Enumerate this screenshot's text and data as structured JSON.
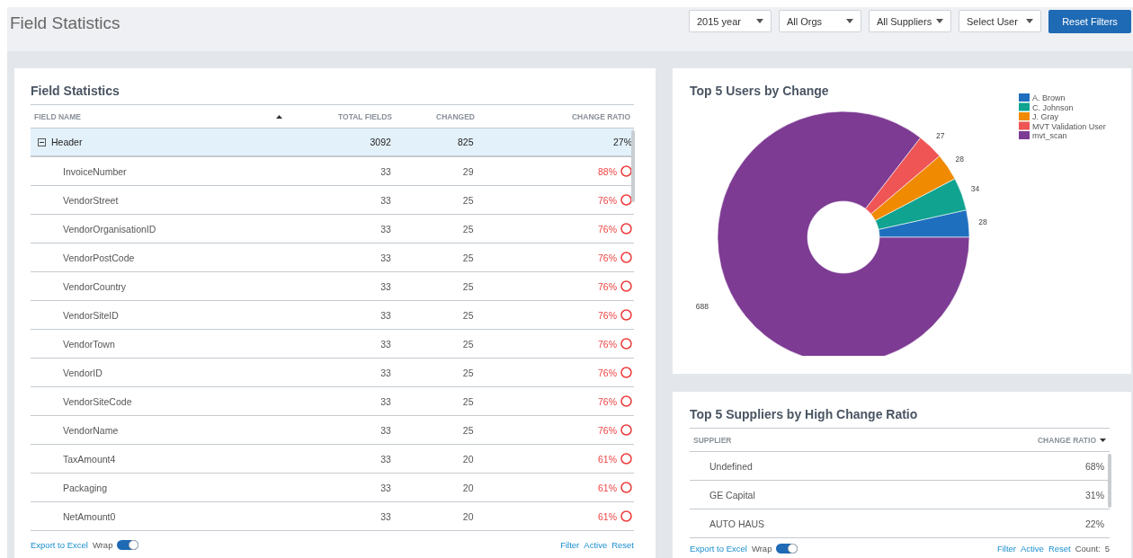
{
  "page": {
    "title": "Field Statistics"
  },
  "filters": [
    {
      "value": "2015 year"
    },
    {
      "value": "All Orgs"
    },
    {
      "value": "All Suppliers"
    },
    {
      "value": "Select User"
    }
  ],
  "reset_button": "Reset Filters",
  "field_statistics": {
    "title": "Field Statistics",
    "columns": [
      "FIELD NAME",
      "TOTAL FIELDS",
      "CHANGED",
      "CHANGE RATIO"
    ],
    "rows": [
      {
        "name": "Header",
        "total": "3092",
        "changed": "825",
        "ratio": "27%",
        "expanded": true,
        "selected": true,
        "alert": false,
        "children": [
          {
            "name": "InvoiceNumber",
            "total": "33",
            "changed": "29",
            "ratio": "88%",
            "selected": false,
            "alert": true
          },
          {
            "name": "VendorStreet",
            "total": "33",
            "changed": "25",
            "ratio": "76%",
            "selected": false,
            "alert": true
          },
          {
            "name": "VendorOrganisationID",
            "total": "33",
            "changed": "25",
            "ratio": "76%",
            "selected": false,
            "alert": true
          },
          {
            "name": "VendorPostCode",
            "total": "33",
            "changed": "25",
            "ratio": "76%",
            "selected": false,
            "alert": true
          },
          {
            "name": "VendorCountry",
            "total": "33",
            "changed": "25",
            "ratio": "76%",
            "selected": false,
            "alert": true
          },
          {
            "name": "VendorSiteID",
            "total": "33",
            "changed": "25",
            "ratio": "76%",
            "selected": false,
            "alert": true
          },
          {
            "name": "VendorTown",
            "total": "33",
            "changed": "25",
            "ratio": "76%",
            "selected": false,
            "alert": true
          },
          {
            "name": "VendorID",
            "total": "33",
            "changed": "25",
            "ratio": "76%",
            "selected": false,
            "alert": true
          },
          {
            "name": "VendorSiteCode",
            "total": "33",
            "changed": "25",
            "ratio": "76%",
            "selected": false,
            "alert": true
          },
          {
            "name": "VendorName",
            "total": "33",
            "changed": "25",
            "ratio": "76%",
            "selected": false,
            "alert": true
          },
          {
            "name": "TaxAmount4",
            "total": "33",
            "changed": "20",
            "ratio": "61%",
            "selected": false,
            "alert": true
          },
          {
            "name": "Packaging",
            "total": "33",
            "changed": "20",
            "ratio": "61%",
            "selected": false,
            "alert": true
          },
          {
            "name": "NetAmount0",
            "total": "33",
            "changed": "20",
            "ratio": "61%",
            "selected": false,
            "alert": true
          }
        ]
      }
    ],
    "footer": {
      "export": "Export to Excel",
      "wrap_label": "Wrap",
      "wrap": true,
      "links": [
        "Filter",
        "Active",
        "Reset"
      ]
    }
  },
  "top_users": {
    "title": "Top 5 Users by Change",
    "chart_data": {
      "type": "donut",
      "categories": [
        "A. Brown",
        "C. Johnson",
        "J. Gray",
        "MVT Validation User",
        "mvt_scan"
      ],
      "values": [
        28,
        34,
        28,
        27,
        688
      ],
      "colors": [
        "#1f6fbf",
        "#0fa390",
        "#f08a00",
        "#ef5555",
        "#7d3b93"
      ],
      "data_labels": true,
      "legend": "top-right"
    }
  },
  "top_suppliers": {
    "title": "Top 5 Suppliers by High Change Ratio",
    "columns": [
      "SUPPLIER",
      "CHANGE RATIO"
    ],
    "rows": [
      {
        "supplier": "Undefined",
        "ratio": "68%"
      },
      {
        "supplier": "GE Capital",
        "ratio": "31%"
      },
      {
        "supplier": "AUTO HAUS",
        "ratio": "22%"
      }
    ],
    "footer": {
      "export": "Export to Excel",
      "wrap_label": "Wrap",
      "wrap": true,
      "links": [
        "Filter",
        "Active",
        "Reset"
      ],
      "count_label": "Count:",
      "count": "5"
    }
  }
}
